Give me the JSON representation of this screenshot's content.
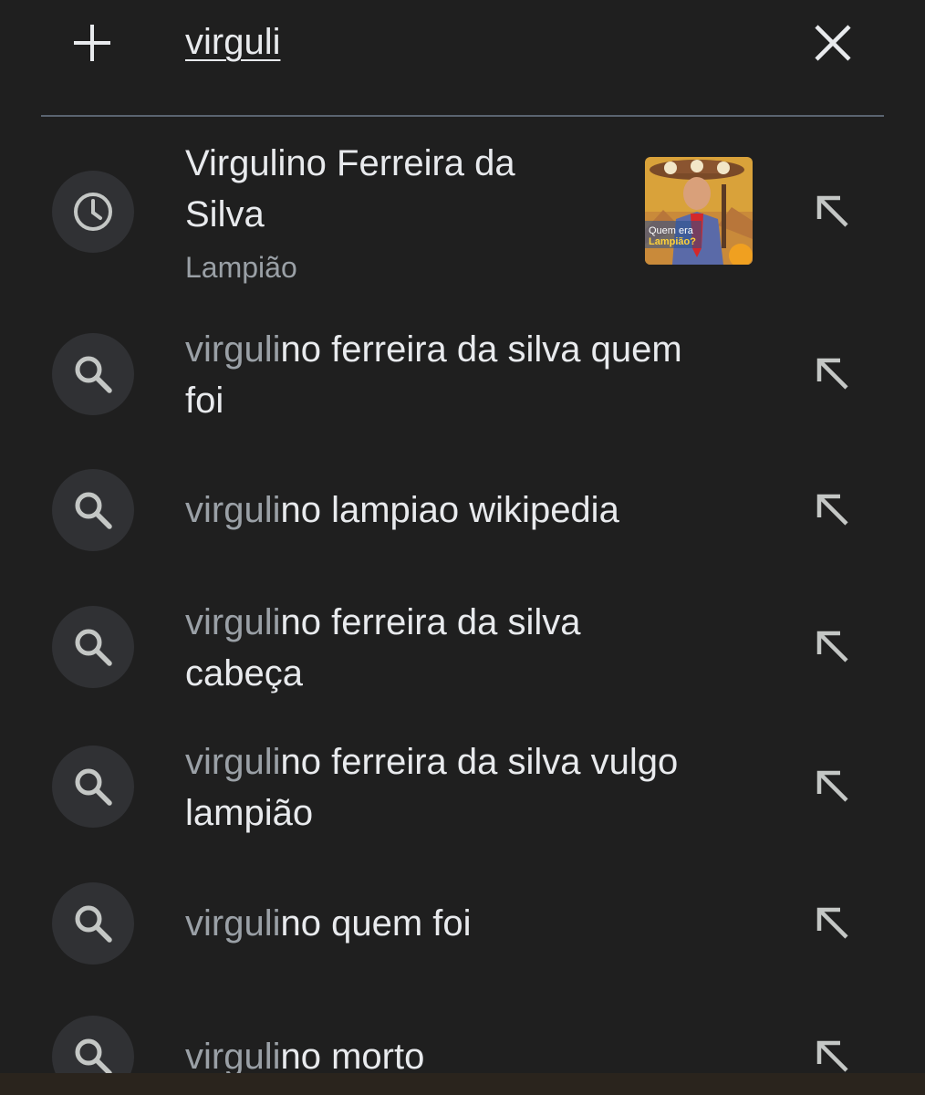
{
  "search": {
    "query": "virguli",
    "add_icon": "plus-icon",
    "clear_icon": "close-icon"
  },
  "suggestions": [
    {
      "type": "history",
      "icon": "history-clock-icon",
      "line1": "Virgulino Ferreira da",
      "line2": "Silva",
      "subtitle": "Lampião",
      "thumbnail_text": [
        "Quem era",
        "Lampião?"
      ]
    },
    {
      "type": "search",
      "icon": "search-icon",
      "prefix": "virguli",
      "rest": "no ferreira da silva quem",
      "line2": "foi"
    },
    {
      "type": "search",
      "icon": "search-icon",
      "prefix": "virguli",
      "rest": "no lampiao wikipedia"
    },
    {
      "type": "search",
      "icon": "search-icon",
      "prefix": "virguli",
      "rest": "no ferreira da silva",
      "line2": "cabeça"
    },
    {
      "type": "search",
      "icon": "search-icon",
      "prefix": "virguli",
      "rest": "no ferreira da silva vulgo",
      "line2": "lampião"
    },
    {
      "type": "search",
      "icon": "search-icon",
      "prefix": "virguli",
      "rest": "no quem foi"
    },
    {
      "type": "search",
      "icon": "search-icon",
      "prefix": "virguli",
      "rest": "no morto"
    }
  ],
  "colors": {
    "background": "#1f1f1f",
    "primary_text": "#e8eaed",
    "secondary_text": "#9aa0a6",
    "icon_circle": "#303134",
    "divider": "#5a6470"
  }
}
